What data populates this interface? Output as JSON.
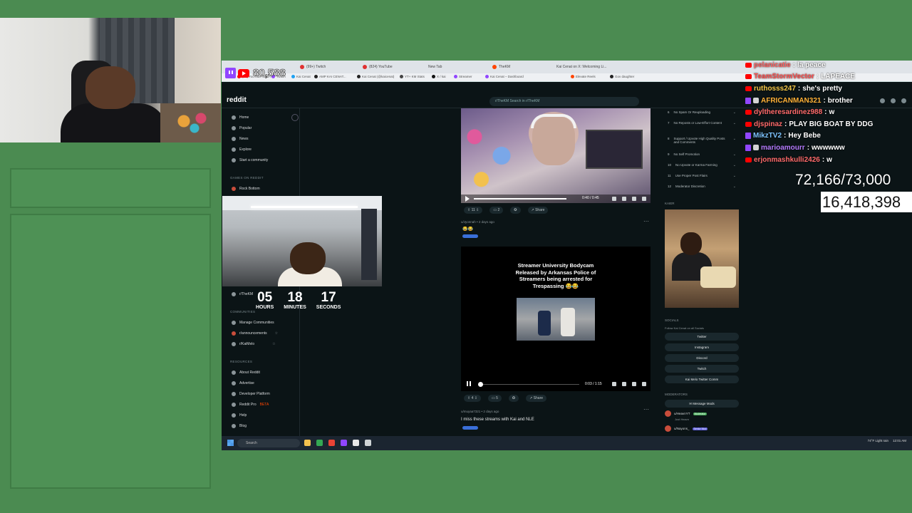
{
  "overlay": {
    "viewer_count": "80,588",
    "goal_text": "72,166/73,000",
    "sub_count": "16,418,398",
    "timer": {
      "hours": "05",
      "hours_label": "HOURS",
      "minutes": "18",
      "minutes_label": "MINUTES",
      "seconds": "17",
      "seconds_label": "SECONDS"
    }
  },
  "chat": [
    {
      "platform": "youtube",
      "user": "pelanicatie",
      "user_color": "#ff5e5e",
      "message": "la peace"
    },
    {
      "platform": "youtube",
      "user": "TeamStormVector",
      "user_color": "#ff4d4d",
      "message": "LAPEACE"
    },
    {
      "platform": "youtube",
      "user": "ruthosss247",
      "user_color": "#f7c948",
      "message": "she's pretty"
    },
    {
      "platform": "twitch",
      "user": "AFRICANMAN321",
      "user_color": "#ffb238",
      "message": "brother"
    },
    {
      "platform": "youtube",
      "user": "dyltheresardinez988",
      "user_color": "#ff6b6b",
      "message": "w"
    },
    {
      "platform": "youtube",
      "user": "djspinaz",
      "user_color": "#ff6b6b",
      "message": "PLAY BIG BOAT BY DDG"
    },
    {
      "platform": "twitch",
      "user": "MikzTV2",
      "user_color": "#7dc4ff",
      "message": "Hey Bebe"
    },
    {
      "platform": "twitch",
      "user": "marioamourr",
      "user_color": "#b57cff",
      "message": "wwwwww"
    },
    {
      "platform": "youtube",
      "user": "erjonmashkulli2426",
      "user_color": "#ff6b6b",
      "message": "w"
    }
  ],
  "browser": {
    "tabs": [
      "(99+) Twitch",
      "(824) YouTube",
      "New Tab",
      "TheKM",
      "Kai Cenat on X: Welcoming Li..."
    ],
    "bookmarks": [
      "(47) YouTube Stud...",
      "Twitch",
      "Kai Cenat",
      "AMP KAI CENAT...",
      "Kai Cenat (@kaicenat)",
      "YT+ KM Stats",
      "X / kai",
      "Streamer",
      "Kai Cenat – Dashboard",
      "Elevate Reels",
      "Gov daughter"
    ]
  },
  "reddit": {
    "logo": "reddit",
    "search_placeholder": "r/TheKM   Search in r/TheKM",
    "sidebar": {
      "items": [
        "Home",
        "Popular",
        "News",
        "Explore",
        "Start a community"
      ],
      "games_header": "GAMES ON REDDIT",
      "game_item": "Rock Bottom",
      "communities_header": "COMMUNITIES",
      "community_items": [
        "Manage Communities",
        "r/announcements",
        "r/KaiMelo"
      ],
      "subreddit_label": "r/TheKM",
      "resources_header": "RESOURCES",
      "resource_items": [
        "About Reddit",
        "Advertise",
        "Developer Platform",
        "Reddit Pro",
        "Help",
        "Blog"
      ],
      "reddit_pro_badge": "BETA"
    },
    "post1": {
      "video_time": "0:40 / 0:45",
      "votes": "11",
      "comments": "2",
      "share": "Share"
    },
    "post2": {
      "author": "u/Jyonnah • 2 days ago",
      "emoji": "😂😂",
      "video_title": "Streamer University Bodycam Released by Arkansas Police of Streamers being arrested for Trespassing 😂😂",
      "video_time": "0:03 / 1:15",
      "votes": "4",
      "comments": "5",
      "share": "Share"
    },
    "post3": {
      "author": "u/muyaa7321 • 2 days ago",
      "title": "I miss these streams with Kai and NLE"
    },
    "rules": [
      {
        "n": "6",
        "text": "No Spam Or Reuploading"
      },
      {
        "n": "7",
        "text": "No Reposts or Low-Effort Content"
      },
      {
        "n": "8",
        "text": "Support / Upvote High Quality Posts and Comments"
      },
      {
        "n": "9",
        "text": "No Self Promotion"
      },
      {
        "n": "10",
        "text": "No Upvote or Karma Farming"
      },
      {
        "n": "11",
        "text": "Use Proper Post Flairs"
      },
      {
        "n": "12",
        "text": "Moderator Discretion"
      }
    ],
    "kaier_header": "KAIER",
    "socials_header": "SOCIALS",
    "socials_sub": "Follow Kai Cenat on all Socials",
    "socials": [
      "Twitter",
      "Instagram",
      "Discord",
      "Twitch",
      "Kai Melo Twitter Comm"
    ],
    "moderators_header": "MODERATORS",
    "message_mods": "Message Mods",
    "mods": [
      {
        "name": "u/HeavnYT",
        "badge": "Moderator",
        "sub": "Just Heavn"
      },
      {
        "name": "u/Nayons_",
        "badge": "Senior Mod"
      }
    ]
  },
  "taskbar": {
    "search": "Search",
    "weather": "74°F Light rain",
    "clock": "12:01 AM"
  }
}
